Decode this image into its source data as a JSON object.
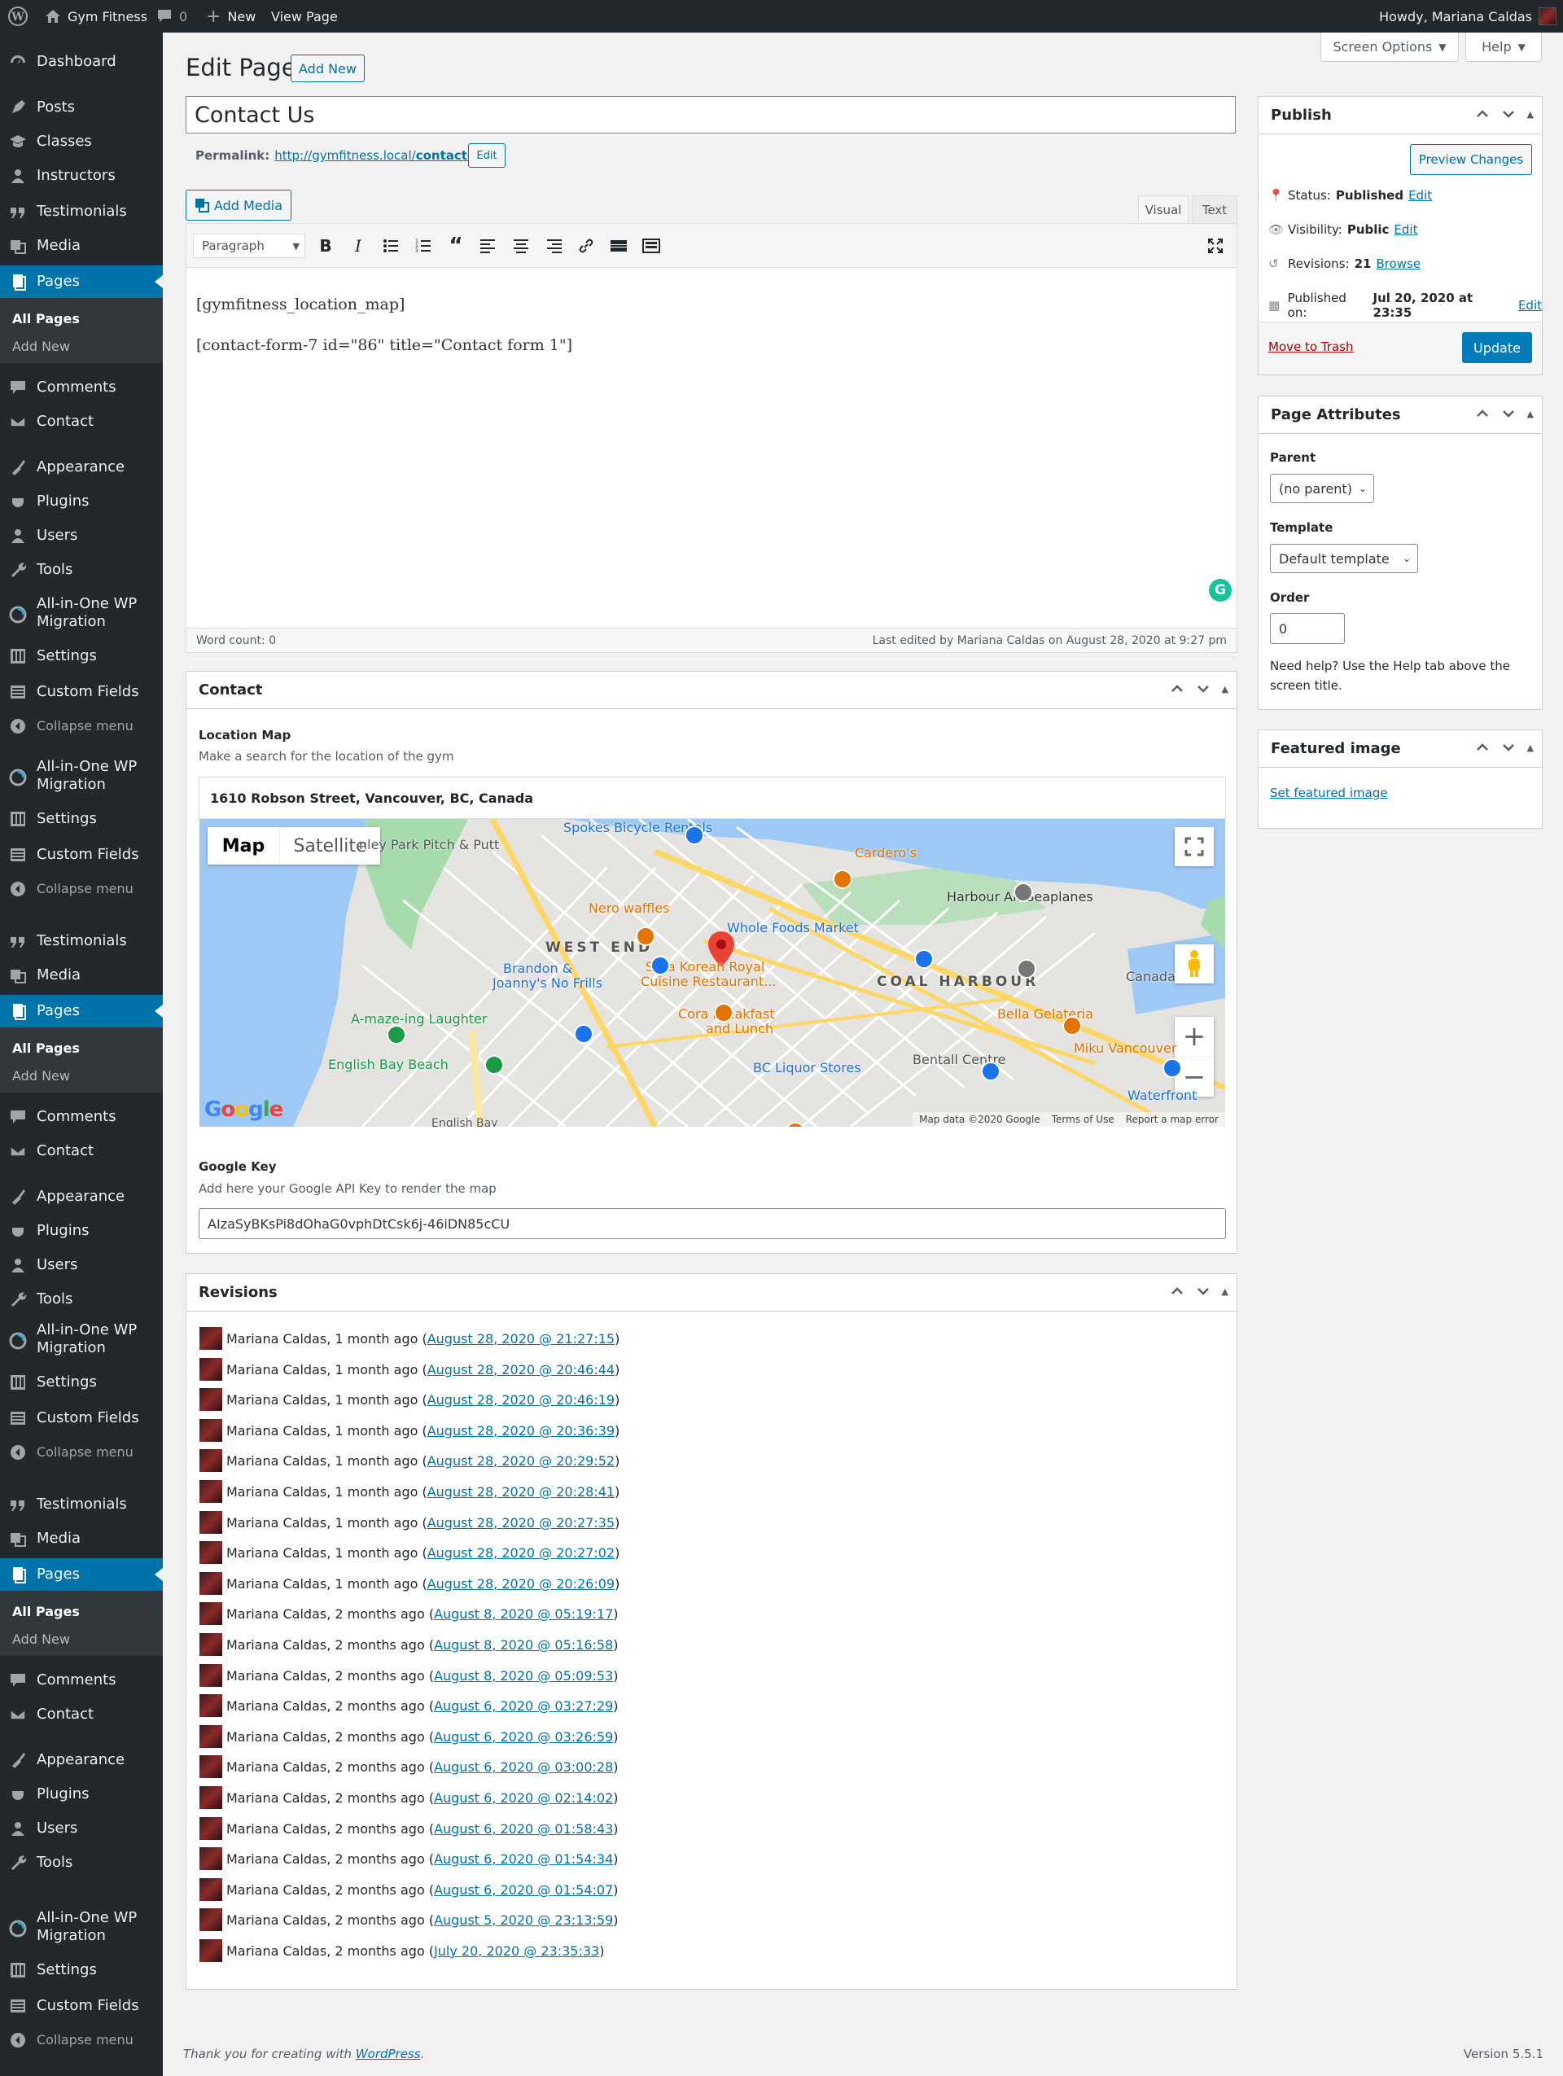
{
  "admin_bar": {
    "site_name": "Gym Fitness",
    "comments_count": "0",
    "new_label": "New",
    "view_page": "View Page",
    "howdy": "Howdy, Mariana Caldas"
  },
  "menu_items": {
    "dashboard": "Dashboard",
    "posts": "Posts",
    "classes": "Classes",
    "instructors": "Instructors",
    "testimonials": "Testimonials",
    "media": "Media",
    "pages": "Pages",
    "all_pages": "All Pages",
    "add_new": "Add New",
    "comments": "Comments",
    "contact": "Contact",
    "appearance": "Appearance",
    "plugins": "Plugins",
    "users": "Users",
    "tools": "Tools",
    "migration_1": "All-in-One WP",
    "migration_2": "Migration",
    "settings": "Settings",
    "custom_fields": "Custom Fields",
    "collapse": "Collapse menu"
  },
  "screen_options": "Screen Options",
  "help": "Help",
  "page_heading": "Edit Page",
  "add_new_button": "Add New",
  "title_value": "Contact Us",
  "permalink": {
    "label": "Permalink:",
    "url_base": "http://gymfitness.local/",
    "slug": "contact-us/",
    "edit": "Edit"
  },
  "add_media": "Add Media",
  "editor_tabs": {
    "visual": "Visual",
    "text": "Text"
  },
  "format_select": "Paragraph",
  "content": {
    "line1": "[gymfitness_location_map]",
    "line2": "[contact-form-7 id=\"86\" title=\"Contact form 1\"]"
  },
  "word_count": "Word count: 0",
  "last_edited": "Last edited by Mariana Caldas on August 28, 2020 at 9:27 pm",
  "contact_box": {
    "title": "Contact",
    "location_map_label": "Location Map",
    "location_map_desc": "Make a search for the location of the gym",
    "address": "1610 Robson Street, Vancouver, BC, Canada",
    "google_key_label": "Google Key",
    "google_key_desc": "Add here your Google API Key to render the map",
    "google_key_value": "AIzaSyBKsPi8dOhaG0vphDtCsk6j-46iDN85cCU"
  },
  "map": {
    "tab_map": "Map",
    "tab_satellite": "Satellite",
    "footer_data": "Map data ©2020 Google",
    "footer_terms": "Terms of Use",
    "footer_report": "Report a map error",
    "google": "Google",
    "labels": [
      "Spokes Bicycle Rentals",
      "Cardero's",
      "Harbour Air Seaplanes",
      "Nero waffles",
      "Whole Foods Market",
      "WEST END",
      "Brandon &",
      "Joanny's No Frills",
      "Sura Korean Royal",
      "Cuisine Restaurant...",
      "COAL HARBOUR",
      "Canada",
      "A-maze-ing Laughter",
      "Cora Breakfast",
      "and Lunch",
      "Bella Gelateria",
      "English Bay Beach",
      "BC Liquor Stores",
      "Bentall Centre",
      "Miku Vancouver",
      "Waterfront",
      "nley Park Pitch & Putt",
      "English Bay"
    ]
  },
  "revisions_box": {
    "title": "Revisions",
    "items": [
      {
        "author": "Mariana Caldas, 1 month ago (",
        "date": "August 28, 2020 @ 21:27:15"
      },
      {
        "author": "Mariana Caldas, 1 month ago (",
        "date": "August 28, 2020 @ 20:46:44"
      },
      {
        "author": "Mariana Caldas, 1 month ago (",
        "date": "August 28, 2020 @ 20:46:19"
      },
      {
        "author": "Mariana Caldas, 1 month ago (",
        "date": "August 28, 2020 @ 20:36:39"
      },
      {
        "author": "Mariana Caldas, 1 month ago (",
        "date": "August 28, 2020 @ 20:29:52"
      },
      {
        "author": "Mariana Caldas, 1 month ago (",
        "date": "August 28, 2020 @ 20:28:41"
      },
      {
        "author": "Mariana Caldas, 1 month ago (",
        "date": "August 28, 2020 @ 20:27:35"
      },
      {
        "author": "Mariana Caldas, 1 month ago (",
        "date": "August 28, 2020 @ 20:27:02"
      },
      {
        "author": "Mariana Caldas, 1 month ago (",
        "date": "August 28, 2020 @ 20:26:09"
      },
      {
        "author": "Mariana Caldas, 2 months ago (",
        "date": "August 8, 2020 @ 05:19:17"
      },
      {
        "author": "Mariana Caldas, 2 months ago (",
        "date": "August 8, 2020 @ 05:16:58"
      },
      {
        "author": "Mariana Caldas, 2 months ago (",
        "date": "August 8, 2020 @ 05:09:53"
      },
      {
        "author": "Mariana Caldas, 2 months ago (",
        "date": "August 6, 2020 @ 03:27:29"
      },
      {
        "author": "Mariana Caldas, 2 months ago (",
        "date": "August 6, 2020 @ 03:26:59"
      },
      {
        "author": "Mariana Caldas, 2 months ago (",
        "date": "August 6, 2020 @ 03:00:28"
      },
      {
        "author": "Mariana Caldas, 2 months ago (",
        "date": "August 6, 2020 @ 02:14:02"
      },
      {
        "author": "Mariana Caldas, 2 months ago (",
        "date": "August 6, 2020 @ 01:58:43"
      },
      {
        "author": "Mariana Caldas, 2 months ago (",
        "date": "August 6, 2020 @ 01:54:34"
      },
      {
        "author": "Mariana Caldas, 2 months ago (",
        "date": "August 6, 2020 @ 01:54:07"
      },
      {
        "author": "Mariana Caldas, 2 months ago (",
        "date": "August 5, 2020 @ 23:13:59"
      },
      {
        "author": "Mariana Caldas, 2 months ago (",
        "date": "July 20, 2020 @ 23:35:33"
      }
    ]
  },
  "publish": {
    "title": "Publish",
    "preview": "Preview Changes",
    "status_label": "Status:",
    "status_value": "Published",
    "visibility_label": "Visibility:",
    "visibility_value": "Public",
    "revisions_label": "Revisions:",
    "revisions_value": "21",
    "browse": "Browse",
    "published_label": "Published on:",
    "published_value": "Jul 20, 2020 at 23:35",
    "edit": "Edit",
    "trash": "Move to Trash",
    "update": "Update"
  },
  "page_attributes": {
    "title": "Page Attributes",
    "parent_label": "Parent",
    "parent_value": "(no parent)",
    "template_label": "Template",
    "template_value": "Default template",
    "order_label": "Order",
    "order_value": "0",
    "help_1": "Need help? Use the Help tab above the",
    "help_2": "screen title."
  },
  "featured_image": {
    "title": "Featured image",
    "link": "Set featured image"
  },
  "footer": {
    "thanks": "Thank you for creating with ",
    "wp": "WordPress",
    "period": ".",
    "version": "Version 5.5.1"
  }
}
